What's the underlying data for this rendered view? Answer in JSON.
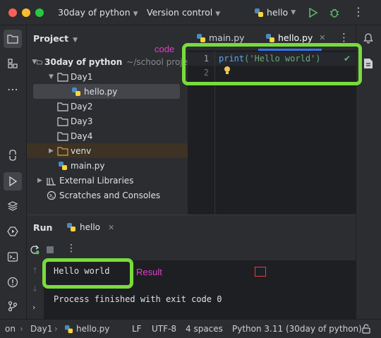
{
  "titlebar": {
    "project": "30day of python",
    "vcs": "Version control",
    "run_config": "hello"
  },
  "project_panel": {
    "title": "Project",
    "tree": [
      {
        "label": "30day of python",
        "suffix": "~/school proje",
        "kind": "root-folder"
      },
      {
        "label": "Day1",
        "kind": "folder"
      },
      {
        "label": "hello.py",
        "kind": "python-file"
      },
      {
        "label": "Day2",
        "kind": "folder"
      },
      {
        "label": "Day3",
        "kind": "folder"
      },
      {
        "label": "Day4",
        "kind": "folder"
      },
      {
        "label": "venv",
        "kind": "folder"
      },
      {
        "label": "main.py",
        "kind": "python-file"
      },
      {
        "label": "External Libraries",
        "kind": "library"
      },
      {
        "label": "Scratches and Consoles",
        "kind": "scratches"
      }
    ]
  },
  "editor": {
    "tabs": [
      {
        "label": "main.py"
      },
      {
        "label": "hello.py",
        "active": true
      }
    ],
    "lines": [
      {
        "number": "1",
        "code_fn": "print",
        "code_rest": "('Hello world')"
      },
      {
        "number": "2"
      }
    ]
  },
  "run_panel": {
    "title": "Run",
    "tab": "hello",
    "output_line1": "Hello world",
    "output_line2": "Process finished with exit code 0"
  },
  "annotations": {
    "code": "code",
    "result": "Result"
  },
  "statusbar": {
    "crumb1": "on",
    "crumb2": "Day1",
    "crumb3": "hello.py",
    "line_sep": "LF",
    "encoding": "UTF-8",
    "indent": "4 spaces",
    "interpreter": "Python 3.11 (30day of python)"
  },
  "colors": {
    "annotation": "#e040c8",
    "highlight_box": "#78dc3c",
    "accent": "#3574f0"
  }
}
